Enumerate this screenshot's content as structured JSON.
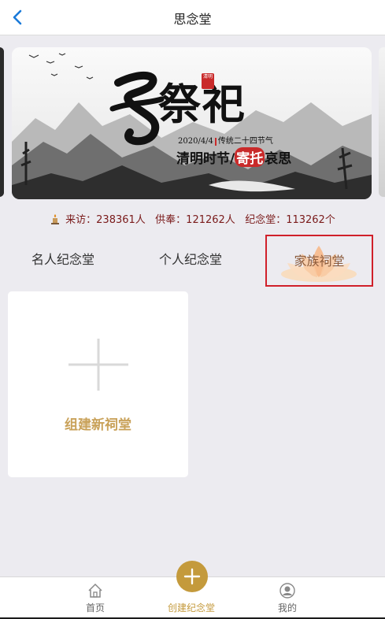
{
  "header": {
    "title": "思念堂"
  },
  "banner": {
    "title": "祭祀",
    "seal": "清明",
    "date": "2020/4/4",
    "date_note": "传统二十四节气",
    "subtitle_prefix": "清明时节/",
    "subtitle_highlight": "寄托",
    "subtitle_suffix": "哀思"
  },
  "stats": {
    "text": "来访：238361人   供奉：121262人   纪念堂：113262个"
  },
  "tabs": [
    {
      "label": "名人纪念堂"
    },
    {
      "label": "个人纪念堂"
    },
    {
      "label": "家族祠堂"
    }
  ],
  "create_card": {
    "label": "组建新祠堂"
  },
  "bottom_nav": {
    "home": "首页",
    "create": "创建纪念堂",
    "me": "我的"
  },
  "colors": {
    "accent": "#c49a3c",
    "highlight": "#d0202a",
    "back": "#1a7ad9"
  }
}
